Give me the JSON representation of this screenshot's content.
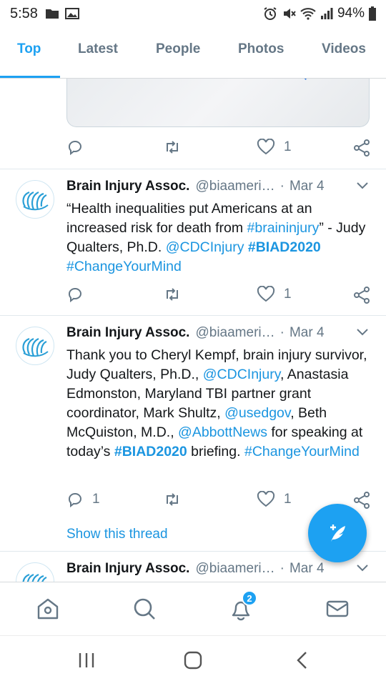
{
  "status_bar": {
    "time": "5:58",
    "battery": "94%"
  },
  "tabs": [
    {
      "label": "Top",
      "active": true
    },
    {
      "label": "Latest",
      "active": false
    },
    {
      "label": "People",
      "active": false
    },
    {
      "label": "Photos",
      "active": false
    },
    {
      "label": "Videos",
      "active": false
    }
  ],
  "prev_tweet": {
    "like_count": "1"
  },
  "tweets": [
    {
      "name": "Brain Injury Assoc.",
      "handle": "@biaameri…",
      "separator": "·",
      "date": "Mar 4",
      "text_parts": [
        {
          "t": "“Health inequalities put Americans at an increased risk for death from ",
          "k": "text"
        },
        {
          "t": "#braininjury",
          "k": "link"
        },
        {
          "t": "” - Judy Qualters, Ph.D. ",
          "k": "text"
        },
        {
          "t": "@CDCInjury",
          "k": "link"
        },
        {
          "t": " ",
          "k": "text"
        },
        {
          "t": "#BIAD2020",
          "k": "tag"
        },
        {
          "t": " ",
          "k": "text"
        },
        {
          "t": "#ChangeYourMind",
          "k": "link"
        }
      ],
      "reply_count": "",
      "like_count": "1"
    },
    {
      "name": "Brain Injury Assoc.",
      "handle": "@biaameri…",
      "separator": "·",
      "date": "Mar 4",
      "text_parts": [
        {
          "t": "Thank you to Cheryl Kempf, brain injury survivor, Judy Qualters, Ph.D., ",
          "k": "text"
        },
        {
          "t": "@CDCInjury",
          "k": "link"
        },
        {
          "t": ", Anastasia Edmonston, Maryland TBI partner grant coordinator, Mark Shultz, ",
          "k": "text"
        },
        {
          "t": "@usedgov",
          "k": "link"
        },
        {
          "t": ", Beth McQuiston, M.D., ",
          "k": "text"
        },
        {
          "t": "@AbbottNews",
          "k": "link"
        },
        {
          "t": " for speaking at today’s ",
          "k": "text"
        },
        {
          "t": "#BIAD2020",
          "k": "tag"
        },
        {
          "t": " briefing. ",
          "k": "text"
        },
        {
          "t": "#ChangeYourMind",
          "k": "link"
        }
      ],
      "reply_count": "1",
      "like_count": "1",
      "show_thread": "Show this thread"
    },
    {
      "name": "Brain Injury Assoc.",
      "handle": "@biaameri…",
      "separator": "·",
      "date": "Mar 4"
    }
  ],
  "bottom_nav": {
    "notifications_badge": "2"
  },
  "colors": {
    "accent": "#1da1f2",
    "link": "#1b95e0",
    "muted": "#657786"
  }
}
